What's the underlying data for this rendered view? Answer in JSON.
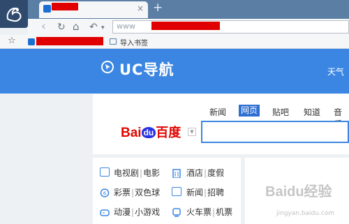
{
  "browser": {
    "tab_close": "×",
    "new_tab": "+",
    "url_prefix": "www",
    "nav": {
      "back": "‹",
      "forward": "›",
      "refresh": "↻",
      "home": "⌂",
      "undo": "↶",
      "dropdown": "▾"
    },
    "bookmarks": {
      "star": "☆",
      "import_label": "导入书签"
    }
  },
  "page": {
    "brand": "UC导航",
    "weather_label": "天气",
    "search_tabs": [
      "新闻",
      "网页",
      "贴吧",
      "知道",
      "音乐"
    ],
    "active_tab": "网页",
    "baidu_bai": "Bai",
    "baidu_du": "du",
    "baidu_cn": "百度",
    "links": [
      {
        "icon": "tv-icon",
        "a": "电视剧",
        "b": "电影"
      },
      {
        "icon": "hotel-icon",
        "a": "酒店",
        "b": "度假"
      },
      {
        "icon": "lottery-icon",
        "a": "彩票",
        "b": "双色球"
      },
      {
        "icon": "news-icon",
        "a": "新闻",
        "b": "招聘"
      },
      {
        "icon": "game-icon",
        "a": "动漫",
        "b": "小游戏"
      },
      {
        "icon": "train-icon",
        "a": "火车票",
        "b": "机票"
      }
    ],
    "watermark": "Baidu经验",
    "watermark_sub": "jingyan.baidu.com"
  },
  "colors": {
    "accent": "#3b86e2",
    "titlebar": "#5b7ea5",
    "redaction": "#e00000"
  }
}
